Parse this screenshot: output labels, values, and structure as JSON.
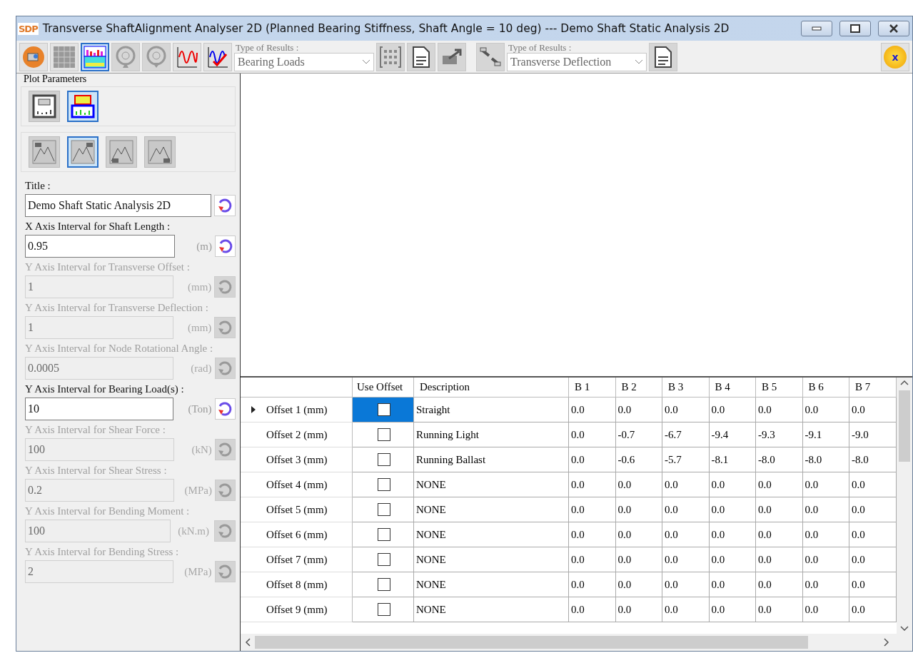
{
  "window": {
    "logo": "SDP",
    "title": "Transverse ShaftAlignment Analyser 2D (Planned Bearing Stiffness, Shaft Angle = 10 deg) --- Demo Shaft Static Analysis 2D"
  },
  "toolbar": {
    "view_buttons": [
      {
        "kind": "table",
        "selected": false
      },
      {
        "kind": "chart",
        "selected": true
      }
    ],
    "bearing_buttons": [
      {
        "kind": "up",
        "disabled": true
      },
      {
        "kind": "down",
        "disabled": true
      }
    ],
    "result_selectors": [
      {
        "label": "Type of Results :",
        "value": "Bearing Loads"
      },
      {
        "label": "Type of Results :",
        "value": "Transverse Deflection"
      }
    ],
    "exit_label": "x"
  },
  "plot_parameters": {
    "title": "Plot Parameters",
    "layout_buttons": [
      {
        "selected": false
      },
      {
        "selected": true
      }
    ],
    "legend_buttons": [
      {
        "kind": "top-left",
        "selected": false
      },
      {
        "kind": "top-right",
        "selected": true
      },
      {
        "kind": "bottom-left",
        "selected": false
      },
      {
        "kind": "bottom-right",
        "selected": false
      }
    ],
    "fields": [
      {
        "label": "Title :",
        "value": "Demo Shaft Static Analysis 2D",
        "enabled": true
      },
      {
        "label": "X Axis Interval for Shaft Length :",
        "value": "0.95",
        "unit": "(m)",
        "enabled": true
      },
      {
        "label": "Y Axis Interval for Transverse Offset :",
        "value": "1",
        "unit": "(mm)",
        "enabled": false
      },
      {
        "label": "Y Axis Interval for Transverse Deflection :",
        "value": "1",
        "unit": "(mm)",
        "enabled": false
      },
      {
        "label": "Y Axis Interval for Node Rotational Angle :",
        "value": "0.0005",
        "unit": "(rad)",
        "enabled": false
      },
      {
        "label": "Y Axis Interval for Bearing Load(s) :",
        "value": "10",
        "unit": "(Ton)",
        "enabled": true
      },
      {
        "label": "Y Axis Interval for Shear Force :",
        "value": "100",
        "unit": "(kN)",
        "enabled": false
      },
      {
        "label": "Y Axis Interval for Shear Stress :",
        "value": "0.2",
        "unit": "(MPa)",
        "enabled": false
      },
      {
        "label": "Y Axis Interval for Bending Moment :",
        "value": "100",
        "unit": "(kN.m)",
        "enabled": false
      },
      {
        "label": "Y Axis Interval for Bending Stress :",
        "value": "2",
        "unit": "(MPa)",
        "enabled": false
      }
    ]
  },
  "table": {
    "columns": [
      "Use Offset",
      "Description",
      "B 1",
      "B 2",
      "B 3",
      "B 4",
      "B 5",
      "B 6",
      "B 7"
    ],
    "rows": [
      {
        "label": "Offset 1 (mm)",
        "current": true,
        "use_offset": false,
        "selected": true,
        "description": "Straight",
        "values": [
          "0.0",
          "0.0",
          "0.0",
          "0.0",
          "0.0",
          "0.0",
          "0.0"
        ]
      },
      {
        "label": "Offset 2 (mm)",
        "current": false,
        "use_offset": false,
        "selected": false,
        "description": "Running Light",
        "values": [
          "0.0",
          "-0.7",
          "-6.7",
          "-9.4",
          "-9.3",
          "-9.1",
          "-9.0"
        ]
      },
      {
        "label": "Offset 3 (mm)",
        "current": false,
        "use_offset": false,
        "selected": false,
        "description": "Running Ballast",
        "values": [
          "0.0",
          "-0.6",
          "-5.7",
          "-8.1",
          "-8.0",
          "-8.0",
          "-8.0"
        ]
      },
      {
        "label": "Offset 4 (mm)",
        "current": false,
        "use_offset": false,
        "selected": false,
        "description": "NONE",
        "values": [
          "0.0",
          "0.0",
          "0.0",
          "0.0",
          "0.0",
          "0.0",
          "0.0"
        ]
      },
      {
        "label": "Offset 5 (mm)",
        "current": false,
        "use_offset": false,
        "selected": false,
        "description": "NONE",
        "values": [
          "0.0",
          "0.0",
          "0.0",
          "0.0",
          "0.0",
          "0.0",
          "0.0"
        ]
      },
      {
        "label": "Offset 6 (mm)",
        "current": false,
        "use_offset": false,
        "selected": false,
        "description": "NONE",
        "values": [
          "0.0",
          "0.0",
          "0.0",
          "0.0",
          "0.0",
          "0.0",
          "0.0"
        ]
      },
      {
        "label": "Offset 7 (mm)",
        "current": false,
        "use_offset": false,
        "selected": false,
        "description": "NONE",
        "values": [
          "0.0",
          "0.0",
          "0.0",
          "0.0",
          "0.0",
          "0.0",
          "0.0"
        ]
      },
      {
        "label": "Offset 8 (mm)",
        "current": false,
        "use_offset": false,
        "selected": false,
        "description": "NONE",
        "values": [
          "0.0",
          "0.0",
          "0.0",
          "0.0",
          "0.0",
          "0.0",
          "0.0"
        ]
      },
      {
        "label": "Offset 9 (mm)",
        "current": false,
        "use_offset": false,
        "selected": false,
        "description": "NONE",
        "values": [
          "0.0",
          "0.0",
          "0.0",
          "0.0",
          "0.0",
          "0.0",
          "0.0"
        ]
      }
    ]
  }
}
